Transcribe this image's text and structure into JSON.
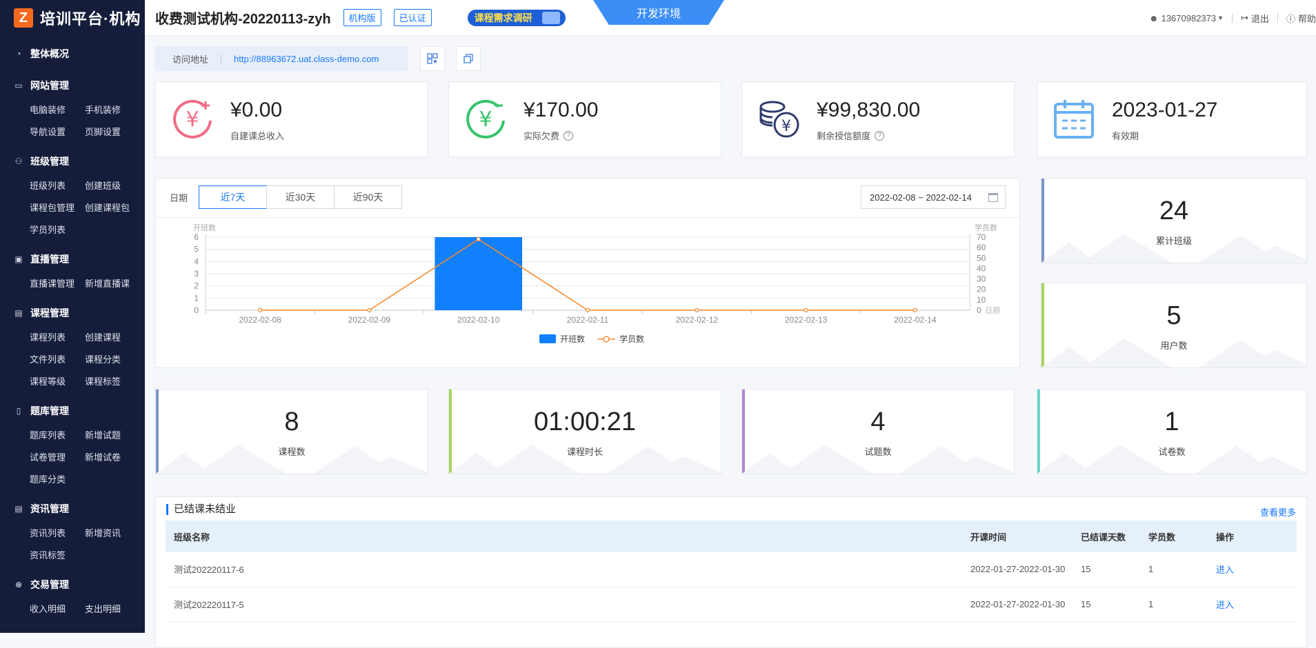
{
  "sidebar": {
    "logo_text": "培训平台·机构",
    "groups": [
      {
        "title": "整体概况",
        "icon": "pie-icon",
        "items": []
      },
      {
        "title": "网站管理",
        "icon": "monitor-icon",
        "items": [
          "电脑装修",
          "手机装修",
          "导航设置",
          "页脚设置"
        ]
      },
      {
        "title": "班级管理",
        "icon": "users-icon",
        "items": [
          "班级列表",
          "创建班级",
          "课程包管理",
          "创建课程包",
          "学员列表"
        ]
      },
      {
        "title": "直播管理",
        "icon": "live-icon",
        "items": [
          "直播课管理",
          "新增直播课"
        ]
      },
      {
        "title": "课程管理",
        "icon": "book-icon",
        "items": [
          "课程列表",
          "创建课程",
          "文件列表",
          "课程分类",
          "课程等级",
          "课程标签"
        ]
      },
      {
        "title": "题库管理",
        "icon": "doc-icon",
        "items": [
          "题库列表",
          "新增试题",
          "试卷管理",
          "新增试卷",
          "题库分类"
        ]
      },
      {
        "title": "资讯管理",
        "icon": "news-icon",
        "items": [
          "资讯列表",
          "新增资讯",
          "资讯标签"
        ]
      },
      {
        "title": "交易管理",
        "icon": "trade-icon",
        "items": [
          "收入明细",
          "支出明细"
        ]
      }
    ]
  },
  "topbar": {
    "org_title": "收费测试机构-20220113-zyh",
    "tag_edition": "机构版",
    "tag_verified": "已认证",
    "survey": "课程需求调研",
    "env": "开发环境",
    "user": "13670982373",
    "logout": "退出",
    "help": "帮助"
  },
  "access": {
    "label": "访问地址",
    "url": "http://88963672.uat.class-demo.com"
  },
  "finance": [
    {
      "amount": "¥0.00",
      "label": "自建课总收入",
      "help": false
    },
    {
      "amount": "¥170.00",
      "label": "实际欠费",
      "help": true
    },
    {
      "amount": "¥99,830.00",
      "label": "剩余授信额度",
      "help": true
    },
    {
      "amount": "2023-01-27",
      "label": "有效期",
      "help": false
    }
  ],
  "chart_panel": {
    "date_label": "日期",
    "ranges": [
      "近7天",
      "近30天",
      "近90天"
    ],
    "active_range": "近7天",
    "date_range": "2022-02-08 ~ 2022-02-14"
  },
  "chart_data": {
    "type": "bar",
    "categories": [
      "2022-02-08",
      "2022-02-09",
      "2022-02-10",
      "2022-02-11",
      "2022-02-12",
      "2022-02-13",
      "2022-02-14"
    ],
    "series": [
      {
        "name": "开班数",
        "type": "bar",
        "axis": "left",
        "values": [
          0,
          0,
          6,
          0,
          0,
          0,
          0
        ]
      },
      {
        "name": "学员数",
        "type": "line",
        "axis": "right",
        "values": [
          0,
          0,
          68,
          0,
          0,
          0,
          0
        ]
      }
    ],
    "ylabel": "开班数",
    "y2label": "学员数",
    "xlabel": "日期",
    "ylim": [
      0,
      6
    ],
    "y2lim": [
      0,
      70
    ],
    "yticks": [
      "0",
      "1",
      "2",
      "3",
      "4",
      "5",
      "6"
    ],
    "y2ticks": [
      "0",
      "10",
      "20",
      "30",
      "40",
      "50",
      "60",
      "70"
    ],
    "grid": true,
    "legend": "bottom",
    "colors": {
      "bar": "#1080ff",
      "line": "#f5882a"
    }
  },
  "side_stats": [
    {
      "value": "24",
      "label": "累计班级",
      "color": "#7f95c9"
    },
    {
      "value": "5",
      "label": "用户数",
      "color": "#a8d55e"
    }
  ],
  "bottom_stats": [
    {
      "value": "8",
      "label": "课程数",
      "color": "#7f95c9"
    },
    {
      "value": "01:00:21",
      "label": "课程时长",
      "color": "#a8d55e"
    },
    {
      "value": "4",
      "label": "试题数",
      "color": "#b383d9"
    },
    {
      "value": "1",
      "label": "试卷数",
      "color": "#6fd3c9"
    }
  ],
  "table": {
    "title": "已结课未结业",
    "more": "查看更多",
    "headers": [
      "班级名称",
      "开课时间",
      "已结课天数",
      "学员数",
      "操作"
    ],
    "rows": [
      [
        "测试202220117-6",
        "2022-01-27-2022-01-30",
        "15",
        "1",
        "进入"
      ],
      [
        "测试202220117-5",
        "2022-01-27-2022-01-30",
        "15",
        "1",
        "进入"
      ]
    ]
  }
}
